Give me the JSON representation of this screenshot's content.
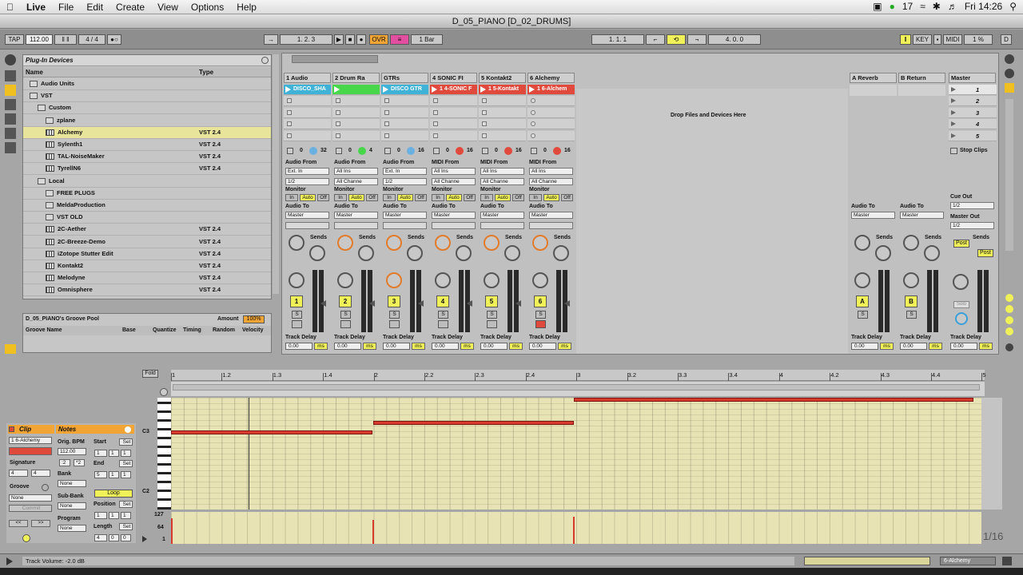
{
  "menubar": {
    "apple": "",
    "items": [
      "Live",
      "File",
      "Edit",
      "Create",
      "View",
      "Options",
      "Help"
    ],
    "status_count": "17",
    "clock": "Fri 14:26"
  },
  "window": {
    "title": "D_05_PIANO  [D_02_DRUMS]"
  },
  "transport": {
    "tap": "TAP",
    "tempo": "112.00",
    "meter": "4 / 4",
    "position": "1.   2.   3",
    "ovr": "OVR",
    "quantize": "1 Bar",
    "loop_start": "1.   1.   1",
    "loop_length": "4.   0.   0",
    "key": "KEY",
    "midi": "MIDI",
    "cpu": "1 %",
    "d": "D"
  },
  "browser": {
    "title": "Plug-In Devices",
    "col_name": "Name",
    "col_type": "Type",
    "rows": [
      {
        "name": "Audio Units",
        "type": "",
        "kind": "folder"
      },
      {
        "name": "VST",
        "type": "",
        "kind": "folder"
      },
      {
        "name": "Custom",
        "type": "",
        "kind": "folder"
      },
      {
        "name": "zplane",
        "type": "",
        "kind": "folder"
      },
      {
        "name": "Alchemy",
        "type": "VST 2.4",
        "kind": "plug"
      },
      {
        "name": "Sylenth1",
        "type": "VST 2.4",
        "kind": "plug"
      },
      {
        "name": "TAL-NoiseMaker",
        "type": "VST 2.4",
        "kind": "plug"
      },
      {
        "name": "TyrellN6",
        "type": "VST 2.4",
        "kind": "plug"
      },
      {
        "name": "Local",
        "type": "",
        "kind": "folder"
      },
      {
        "name": "FREE PLUGS",
        "type": "",
        "kind": "folder"
      },
      {
        "name": "MeldaProduction",
        "type": "",
        "kind": "folder"
      },
      {
        "name": "VST OLD",
        "type": "",
        "kind": "folder"
      },
      {
        "name": "2C-Aether",
        "type": "VST 2.4",
        "kind": "plug"
      },
      {
        "name": "2C-Breeze-Demo",
        "type": "VST 2.4",
        "kind": "plug"
      },
      {
        "name": "iZotope Stutter Edit",
        "type": "VST 2.4",
        "kind": "plug"
      },
      {
        "name": "Kontakt2",
        "type": "VST 2.4",
        "kind": "plug"
      },
      {
        "name": "Melodyne",
        "type": "VST 2.4",
        "kind": "plug"
      },
      {
        "name": "Omnisphere",
        "type": "VST 2.4",
        "kind": "plug"
      }
    ]
  },
  "groove_pool": {
    "title": "D_05_PIANO's Groove Pool",
    "amount_label": "Amount",
    "amount": "100%",
    "cols": [
      "Groove Name",
      "Base",
      "Quantize",
      "Timing",
      "Random",
      "Velocity"
    ]
  },
  "session": {
    "drop_text": "Drop Files and Devices Here",
    "stop_clips": "Stop Clips",
    "tracks": [
      {
        "name": "1 Audio",
        "clip": "DISCO_SHA",
        "clip_color": "#3fb2d8",
        "num": "1",
        "from_label": "Audio From",
        "from": "Ext. In",
        "chan": "1/2",
        "send_a": "0",
        "send_b": "32"
      },
      {
        "name": "2 Drum Ra",
        "clip": "",
        "clip_color": "#48d64a",
        "num": "2",
        "from_label": "Audio From",
        "from": "All Ins",
        "chan": "All Channe",
        "send_a": "0",
        "send_b": "4"
      },
      {
        "name": "GTRs",
        "clip": "DISCO GTR",
        "clip_color": "#3fb2d8",
        "num": "3",
        "from_label": "Audio From",
        "from": "Ext. In",
        "chan": "1/2",
        "send_a": "0",
        "send_b": "16"
      },
      {
        "name": "4 SONIC FI",
        "clip": "1 4-SONIC F",
        "clip_color": "#e04a3c",
        "num": "4",
        "from_label": "MIDI From",
        "from": "All Ins",
        "chan": "All Channe",
        "send_a": "0",
        "send_b": "16"
      },
      {
        "name": "5 Kontakt2",
        "clip": "1 5-Kontakt",
        "clip_color": "#e04a3c",
        "num": "5",
        "from_label": "MIDI From",
        "from": "All Ins",
        "chan": "All Channe",
        "send_a": "0",
        "send_b": "16"
      },
      {
        "name": "6 Alchemy",
        "clip": "1 6-Alchem",
        "clip_color": "#e04a3c",
        "num": "6",
        "from_label": "MIDI From",
        "from": "All Ins",
        "chan": "All Channe",
        "send_a": "0",
        "send_b": "16"
      }
    ],
    "labels": {
      "monitor": "Monitor",
      "in": "In",
      "auto": "Auto",
      "off": "Off",
      "audio_to": "Audio To",
      "master": "Master",
      "sends": "Sends",
      "s": "S",
      "track_delay": "Track Delay",
      "delay_val": "0.00",
      "ms": "ms"
    },
    "returns": [
      {
        "name": "A Reverb",
        "num": "A"
      },
      {
        "name": "B Return",
        "num": "B"
      }
    ],
    "master": {
      "name": "Master",
      "scenes": [
        "1",
        "2",
        "3",
        "4",
        "5"
      ],
      "cue_out": "Cue Out",
      "cue_val": "1/2",
      "master_out": "Master Out",
      "master_val": "1/2",
      "post": "Post",
      "solo": "Solo"
    }
  },
  "clip_view": {
    "clip": "Clip",
    "notes": "Notes",
    "clip_name": "1 6-Alchemy",
    "signature": "Signature",
    "sig_num": "4",
    "sig_den": "4",
    "groove": "Groove",
    "groove_val": "None",
    "commit": "Commit",
    "orig_bpm": "Orig. BPM",
    "bpm": "112.00",
    "half": ":2",
    "double": "*2",
    "bank": "Bank",
    "bank_val": "None",
    "sub_bank": "Sub-Bank",
    "sub_val": "None",
    "program": "Program",
    "program_val": "None",
    "start": "Start",
    "start_vals": [
      "1",
      "1",
      "1"
    ],
    "end": "End",
    "end_vals": [
      "5",
      "1",
      "1"
    ],
    "set": "Set",
    "loop": "Loop",
    "position": "Position",
    "pos_vals": [
      "1",
      "1",
      "1"
    ],
    "length": "Length",
    "len_vals": [
      "4",
      "0",
      "0"
    ]
  },
  "editor": {
    "fold": "Fold",
    "ruler": [
      "1",
      "1.2",
      "1.3",
      "1.4",
      "2",
      "2.2",
      "2.3",
      "2.4",
      "3",
      "3.2",
      "3.3",
      "3.4",
      "4",
      "4.2",
      "4.3",
      "4.4",
      "5"
    ],
    "pitch_labels": [
      "C3",
      "C2"
    ],
    "vel_labels": [
      "127",
      "64",
      "1"
    ],
    "grid": "1/16"
  },
  "status": {
    "text": "Track Volume: -2.0 dB",
    "track": "6-Alchemy"
  }
}
